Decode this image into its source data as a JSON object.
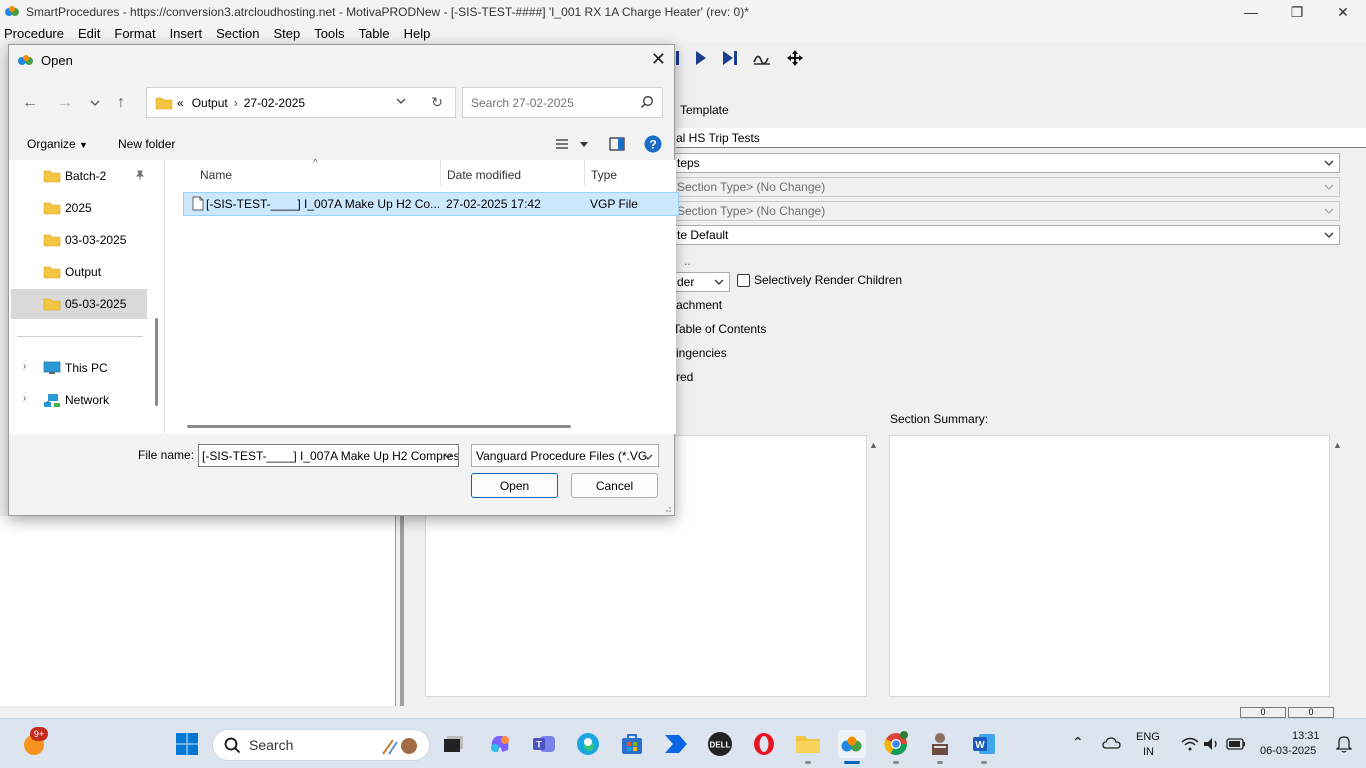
{
  "window": {
    "title": "SmartProcedures - https://conversion3.atrcloudhosting.net - MotivaPRODNew - [-SIS-TEST-####] 'I_001 RX 1A Charge Heater' (rev: 0)*",
    "minimize": "—",
    "maximize": "❐",
    "close": "✕"
  },
  "menu": [
    "Procedure",
    "Edit",
    "Format",
    "Insert",
    "Section",
    "Step",
    "Tools",
    "Table",
    "Help"
  ],
  "background_form": {
    "template_label": "Template",
    "title_value": "al HS Trip Tests",
    "combo1": "teps",
    "combo2": "Section Type> (No Change)",
    "combo3": "Section Type> (No Change)",
    "combo4": "te Default",
    "small_btn": "..",
    "render_combo": "der",
    "selectively_render": "Selectively Render Children",
    "attachment": "achment",
    "toc": "Table of Contents",
    "contingencies": "ingencies",
    "required": "red",
    "section_summary": "Section Summary:"
  },
  "statusbar": [
    "0",
    "0"
  ],
  "dialog": {
    "title": "Open",
    "address": {
      "overflow": "«",
      "crumbs": [
        "Output",
        "27-02-2025"
      ]
    },
    "search_placeholder": "Search 27-02-2025",
    "organize": "Organize",
    "new_folder": "New folder",
    "nav_items": [
      {
        "label": "Batch-2",
        "pinned": true
      },
      {
        "label": "2025"
      },
      {
        "label": "03-03-2025"
      },
      {
        "label": "Output"
      },
      {
        "label": "05-03-2025",
        "selected": true
      }
    ],
    "this_pc": "This PC",
    "network": "Network",
    "columns": {
      "name": "Name",
      "date": "Date modified",
      "type": "Type"
    },
    "files": [
      {
        "name": "[-SIS-TEST-____] I_007A Make Up H2 Co...",
        "date": "27-02-2025 17:42",
        "type": "VGP File"
      }
    ],
    "file_name_label": "File name:",
    "file_name_value": "[-SIS-TEST-____] I_007A Make Up H2 Compress",
    "filter_value": "Vanguard Procedure Files (*.VG",
    "open_btn": "Open",
    "cancel_btn": "Cancel"
  },
  "taskbar": {
    "notification_badge": "9+",
    "search_label": "Search",
    "lang_line1": "ENG",
    "lang_line2": "IN",
    "time": "13:31",
    "date": "06-03-2025"
  },
  "colors": {
    "accent": "#0067c0",
    "selection": "#cce8ff",
    "folder": "#f4c542",
    "toolbar_blue": "#1a3d8f"
  }
}
